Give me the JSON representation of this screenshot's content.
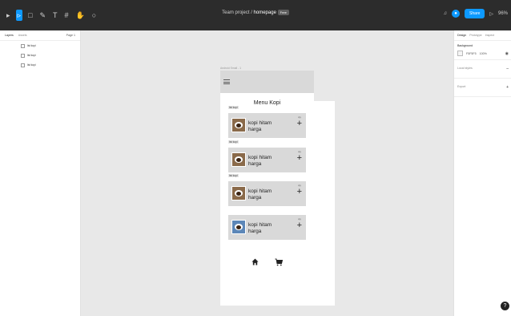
{
  "toolbar": {
    "tools": [
      {
        "icon": "move-tool-icon",
        "glyph": "▸",
        "active": false
      },
      {
        "icon": "frame-tool-icon",
        "glyph": "▹",
        "active": true
      },
      {
        "icon": "rectangle-tool-icon",
        "glyph": "□",
        "active": false
      },
      {
        "icon": "pen-tool-icon",
        "glyph": "✎",
        "active": false
      },
      {
        "icon": "text-tool-icon",
        "glyph": "T",
        "active": false
      },
      {
        "icon": "resources-tool-icon",
        "glyph": "#",
        "active": false
      },
      {
        "icon": "hand-tool-icon",
        "glyph": "✋",
        "active": false
      },
      {
        "icon": "comment-tool-icon",
        "glyph": "○",
        "active": false
      }
    ],
    "project": "Team project",
    "separator": "/",
    "file_name": "homepage",
    "badge": "Free",
    "share_label": "Share",
    "zoom": "96%"
  },
  "left_panel": {
    "tabs": [
      "Layers",
      "Assets"
    ],
    "page": "Page 1",
    "layers": [
      {
        "label": "list kopi",
        "type": "group"
      },
      {
        "label": "list kopi",
        "type": "group"
      },
      {
        "label": "list kopi",
        "type": "group"
      },
      {
        "label": "Android Small - 1",
        "type": "frame"
      }
    ]
  },
  "right_panel": {
    "tabs": [
      "Design",
      "Prototype",
      "Inspect"
    ],
    "background_label": "Background",
    "background_hex": "F5F5F5",
    "background_opacity": "100%",
    "local_styles": "Local styles",
    "export": "Export"
  },
  "canvas": {
    "frame_label": "Android Small - 1",
    "menu_title": "Menu Kopi",
    "cards": [
      {
        "label": "list kopi",
        "name": "kopi hitam",
        "price": "harga",
        "qty": "qty"
      },
      {
        "label": "list kopi",
        "name": "kopi hitam",
        "price": "harga",
        "qty": "qty"
      },
      {
        "label": "list kopi",
        "name": "kopi hitam",
        "price": "harga",
        "qty": "qty"
      },
      {
        "label": "",
        "name": "kopi hitam",
        "price": "harga",
        "qty": "qty"
      }
    ],
    "bottom_nav": [
      {
        "icon": "home-icon",
        "glyph": "⌂"
      },
      {
        "icon": "cart-icon",
        "glyph": "🛒"
      }
    ]
  },
  "help": "?",
  "colors": {
    "toolbar": "#2c2c2c",
    "accent": "#0d99ff",
    "canvas": "#e8e8e8",
    "frame_header": "#d9d9d9"
  }
}
